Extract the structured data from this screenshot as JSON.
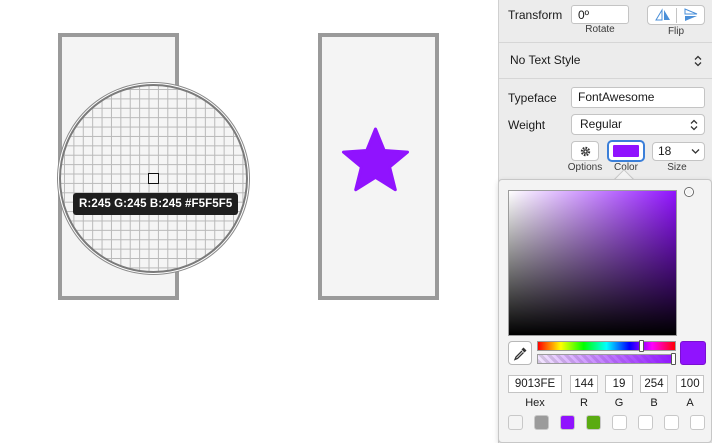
{
  "inspector": {
    "transform": {
      "label": "Transform",
      "rotate_value": "0º",
      "rotate_caption": "Rotate",
      "flip_caption": "Flip"
    },
    "text_style": {
      "value": "No Text Style"
    },
    "typeface": {
      "label": "Typeface",
      "value": "FontAwesome"
    },
    "weight": {
      "label": "Weight",
      "value": "Regular"
    },
    "options_caption": "Options",
    "color_caption": "Color",
    "color_value_hex": "#9013fe",
    "size_value": "18",
    "size_caption": "Size"
  },
  "canvas": {
    "magnifier_readout": "R:245 G:245 B:245 #F5F5F5",
    "artboard_fill": "#f5f5f5",
    "star_icon": "star-icon",
    "star_color": "#9013fe"
  },
  "color_picker": {
    "hue_fraction": 0.76,
    "alpha_fraction": 1.0,
    "fields": [
      {
        "key": "hex",
        "value": "9013FE",
        "caption": "Hex"
      },
      {
        "key": "r",
        "value": "144",
        "caption": "R"
      },
      {
        "key": "g",
        "value": "19",
        "caption": "G"
      },
      {
        "key": "b",
        "value": "254",
        "caption": "B"
      },
      {
        "key": "a",
        "value": "100",
        "caption": "A"
      }
    ],
    "document_colors": [
      "#f4f4f4",
      "#9b9b9b",
      "#9013fe",
      "#5aab12",
      "#ffffff",
      "#ffffff",
      "#ffffff",
      "#ffffff"
    ]
  }
}
